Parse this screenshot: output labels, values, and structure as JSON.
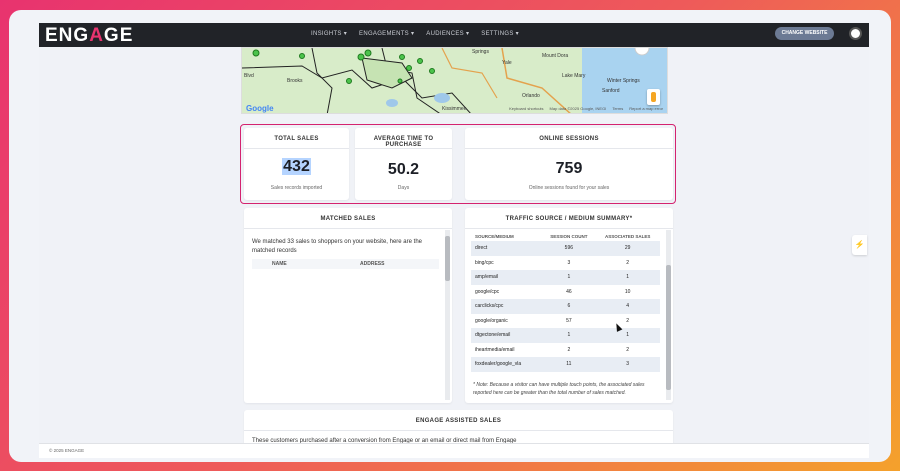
{
  "brand": {
    "logo_pre": "ENG",
    "logo_a": "A",
    "logo_post": "GE",
    "accent": "#e8336f"
  },
  "nav": {
    "items": [
      {
        "label": "INSIGHTS ▾"
      },
      {
        "label": "ENGAGEMENTS ▾"
      },
      {
        "label": "AUDIENCES ▾"
      },
      {
        "label": "SETTINGS ▾"
      }
    ],
    "change_website": "CHANGE WEBSITE"
  },
  "map": {
    "labels": [
      "Springs",
      "Yale",
      "Mount Dora",
      "Lake Mary",
      "Winter Springs",
      "Sanford",
      "Orlando",
      "Kissimmee",
      "Brooks",
      "Blvd"
    ],
    "attribution": [
      "Keyboard shortcuts",
      "Map data ©2025 Google, INEGI",
      "Terms",
      "Report a map error"
    ],
    "google": "Google"
  },
  "stats": {
    "total_sales": {
      "title": "TOTAL SALES",
      "value": "432",
      "sub": "Sales records imported"
    },
    "avg_time": {
      "title": "AVERAGE TIME TO PURCHASE",
      "value": "50.2",
      "sub": "Days"
    },
    "online_sessions": {
      "title": "ONLINE SESSIONS",
      "value": "759",
      "sub": "Online sessions found for your sales"
    }
  },
  "matched_sales": {
    "title": "MATCHED SALES",
    "description": "We matched 33 sales to shoppers on your website, here are the matched records",
    "columns": [
      "NAME",
      "ADDRESS"
    ]
  },
  "traffic": {
    "title": "TRAFFIC SOURCE / MEDIUM SUMMARY*",
    "columns": [
      "SOURCE/MEDIUM",
      "SESSION COUNT",
      "ASSOCIATED SALES"
    ],
    "rows": [
      [
        "direct",
        "596",
        "29"
      ],
      [
        "bing/cpc",
        "3",
        "2"
      ],
      [
        "amp/email",
        "1",
        "1"
      ],
      [
        "google/cpc",
        "46",
        "10"
      ],
      [
        "carclicks/cpc",
        "6",
        "4"
      ],
      [
        "google/organic",
        "57",
        "2"
      ],
      [
        "dtgectone/email",
        "1",
        "1"
      ],
      [
        "iheartmedia/email",
        "2",
        "2"
      ],
      [
        "foxdealer/google_vla",
        "11",
        "3"
      ]
    ],
    "note": "* Note: Because a visitor can have multiple touch points, the associated sales reported here can be greater than the total number of sales matched."
  },
  "assisted": {
    "title": "ENGAGE ASSISTED SALES",
    "description": "These customers purchased after a conversion from Engage or an email or direct mail from Engage"
  },
  "footer": {
    "copyright": "© 2025 ENGAGE"
  }
}
